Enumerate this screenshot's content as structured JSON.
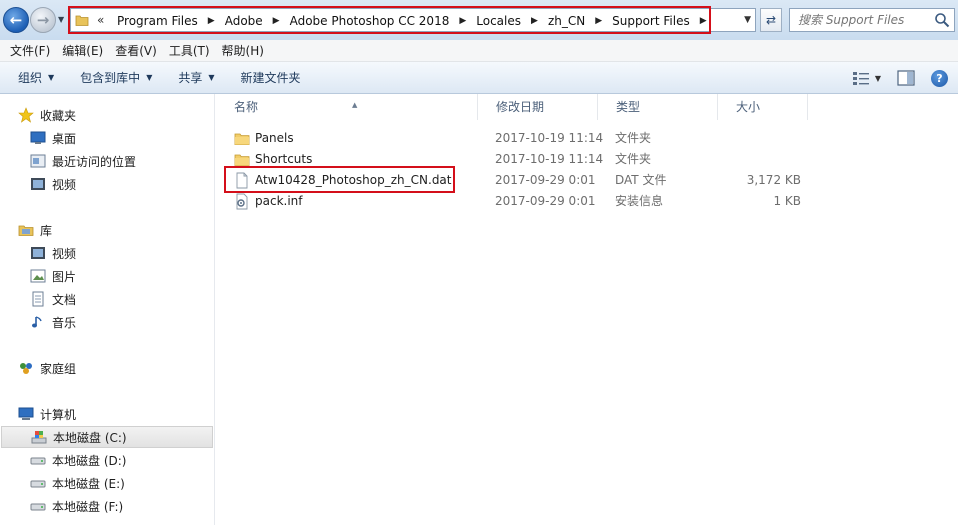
{
  "window": {
    "address": {
      "overflow": "«",
      "crumbs": [
        "Program Files",
        "Adobe",
        "Adobe Photoshop CC 2018",
        "Locales",
        "zh_CN",
        "Support Files"
      ]
    },
    "search_placeholder": "搜索 Support Files"
  },
  "menubar": {
    "items": [
      "文件(F)",
      "编辑(E)",
      "查看(V)",
      "工具(T)",
      "帮助(H)"
    ]
  },
  "commandbar": {
    "organize": "组织",
    "include_library": "包含到库中",
    "share": "共享",
    "new_folder": "新建文件夹"
  },
  "navpane": {
    "favorites": {
      "title": "收藏夹",
      "items": [
        "桌面",
        "最近访问的位置",
        "视频"
      ]
    },
    "libraries": {
      "title": "库",
      "items": [
        "视频",
        "图片",
        "文档",
        "音乐"
      ]
    },
    "homegroup": "家庭组",
    "computer": {
      "title": "计算机",
      "drives": [
        "本地磁盘 (C:)",
        "本地磁盘 (D:)",
        "本地磁盘 (E:)",
        "本地磁盘 (F:)"
      ]
    }
  },
  "filelist": {
    "columns": {
      "name": "名称",
      "date": "修改日期",
      "type": "类型",
      "size": "大小"
    },
    "rows": [
      {
        "name": "Panels",
        "date": "2017-10-19 11:14",
        "type": "文件夹",
        "size": "",
        "icon": "folder-icon"
      },
      {
        "name": "Shortcuts",
        "date": "2017-10-19 11:14",
        "type": "文件夹",
        "size": "",
        "icon": "folder-icon"
      },
      {
        "name": "Atw10428_Photoshop_zh_CN.dat",
        "date": "2017-09-29 0:01",
        "type": "DAT 文件",
        "size": "3,172 KB",
        "icon": "file-icon"
      },
      {
        "name": "pack.inf",
        "date": "2017-09-29 0:01",
        "type": "安装信息",
        "size": "1 KB",
        "icon": "settings-file-icon"
      }
    ]
  },
  "colors": {
    "highlight_red": "#d40f1a",
    "nav_blue": "#1d5fb5"
  }
}
